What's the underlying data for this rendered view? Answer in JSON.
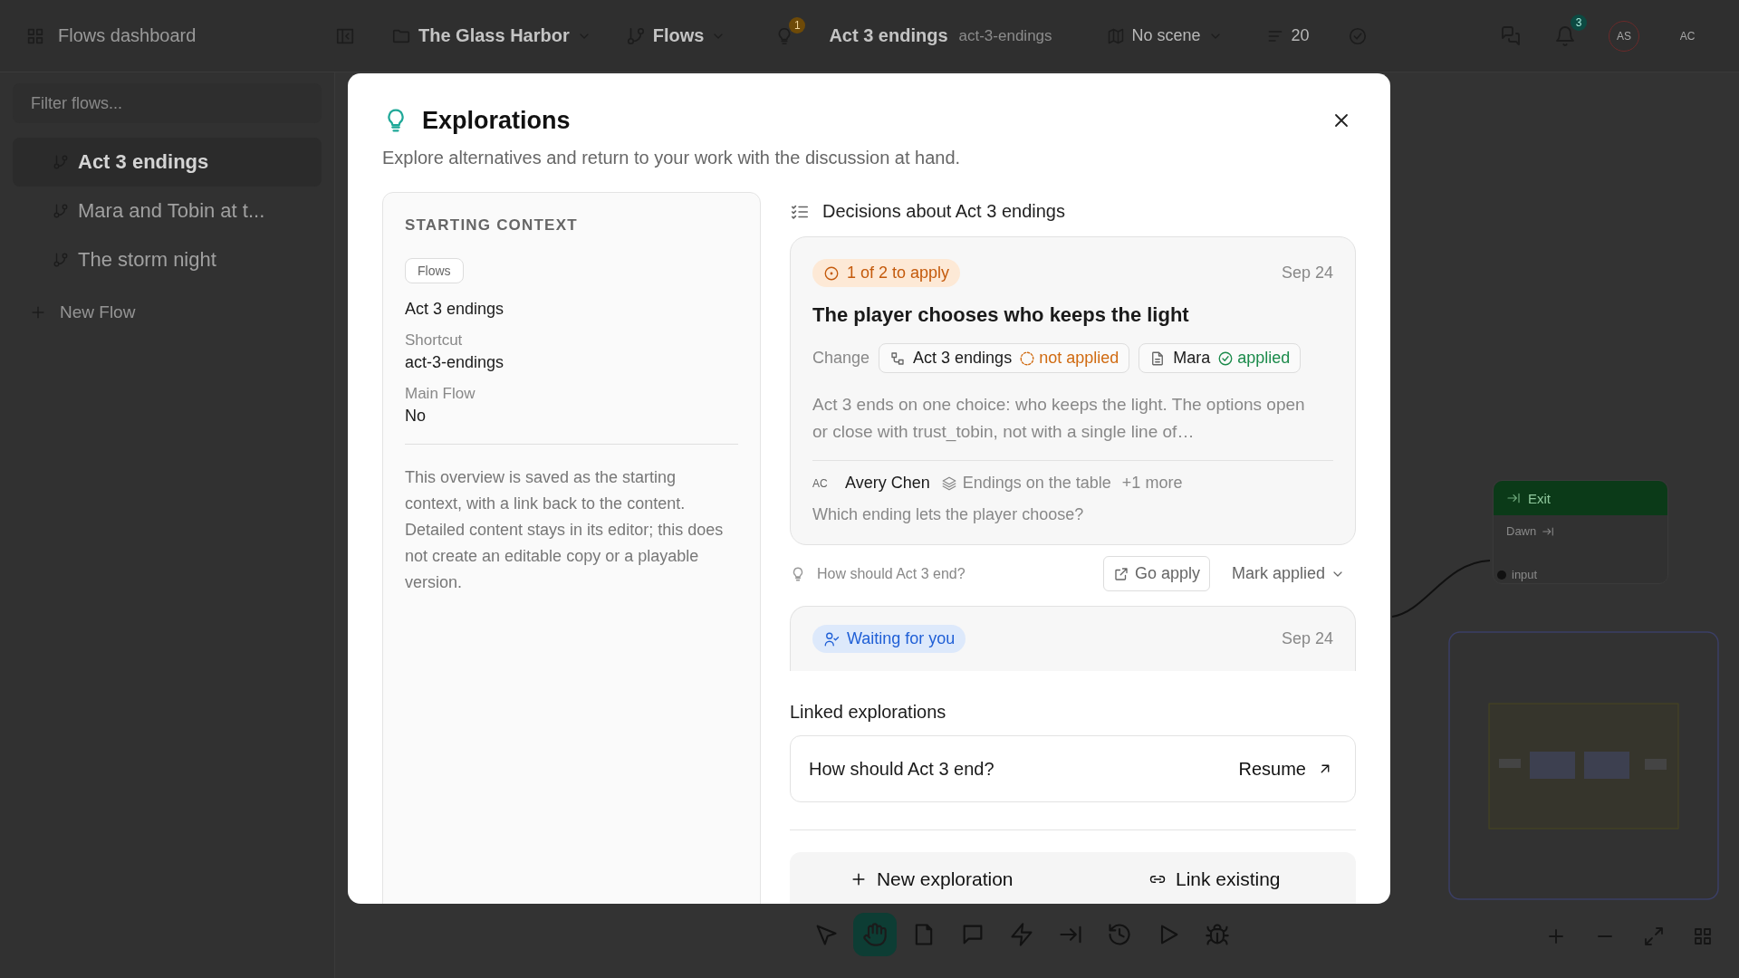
{
  "topbar": {
    "dashboard_label": "Flows dashboard",
    "project": "The Glass Harbor",
    "section": "Flows",
    "ideas_badge": "1",
    "flow_title": "Act 3 endings",
    "flow_shortcut": "act-3-endings",
    "scene": "No scene",
    "count": "20",
    "notifications_badge": "3",
    "avatars": [
      "AS",
      "AC"
    ]
  },
  "sidebar": {
    "filter": {
      "placeholder": "Filter flows..."
    },
    "items": [
      {
        "label": "Act 3 endings",
        "selected": true
      },
      {
        "label": "Mara and Tobin at t...",
        "selected": false
      },
      {
        "label": "The storm night",
        "selected": false
      }
    ],
    "new_button": "New Flow"
  },
  "canvas": {
    "node": {
      "title": "Exit",
      "row": "Dawn",
      "port": "input"
    }
  },
  "toolbar": {
    "tools": [
      {
        "kind": "select",
        "selected": false
      },
      {
        "kind": "hand",
        "selected": true
      },
      {
        "kind": "page",
        "selected": false
      },
      {
        "kind": "comment",
        "selected": false
      },
      {
        "kind": "action",
        "selected": false
      },
      {
        "kind": "exit",
        "selected": false
      },
      {
        "kind": "history",
        "selected": false
      },
      {
        "kind": "play",
        "selected": false
      },
      {
        "kind": "debug",
        "selected": false
      }
    ]
  },
  "modal": {
    "title": "Explorations",
    "subtitle": "Explore alternatives and return to your work with the discussion at hand.",
    "context": {
      "heading": "STARTING CONTEXT",
      "tag": "Flows",
      "name": "Act 3 endings",
      "fields": [
        {
          "label": "Shortcut",
          "value": "act-3-endings"
        },
        {
          "label": "Main Flow",
          "value": "No"
        }
      ],
      "note": "This overview is saved as the starting context, with a link back to the content. Detailed content stays in its editor; this does not create an editable copy or a playable version."
    },
    "decisions": {
      "heading": "Decisions about Act 3 endings",
      "cards": [
        {
          "badge": {
            "kind": "pending",
            "label": "1 of 2 to apply"
          },
          "date": "Sep 24",
          "title": "The player chooses who keeps the light",
          "change_label": "Change",
          "chips": [
            {
              "kind": "flow",
              "label": "Act 3 endings",
              "status": {
                "kind": "pending",
                "label": "not applied"
              }
            },
            {
              "kind": "page",
              "label": "Mara",
              "status": {
                "kind": "done",
                "label": "applied"
              }
            }
          ],
          "description": "Act 3 ends on one choice: who keeps the light. The options open or close with trust_tobin, not with a single line of…",
          "author_initials": "AC",
          "author": "Avery Chen",
          "topic": "Endings on the table",
          "more": "+1 more",
          "question": "Which ending lets the player choose?",
          "footer": {
            "exploration": "How should Act 3 end?",
            "go_button": "Go apply",
            "mark_button": "Mark applied"
          }
        },
        {
          "badge": {
            "kind": "waiting",
            "label": "Waiting for you"
          },
          "date": "Sep 24"
        }
      ]
    },
    "linked": {
      "heading": "Linked explorations",
      "items": [
        {
          "title": "How should Act 3 end?",
          "action": "Resume"
        }
      ]
    },
    "actions": [
      "New exploration",
      "Link existing"
    ]
  }
}
